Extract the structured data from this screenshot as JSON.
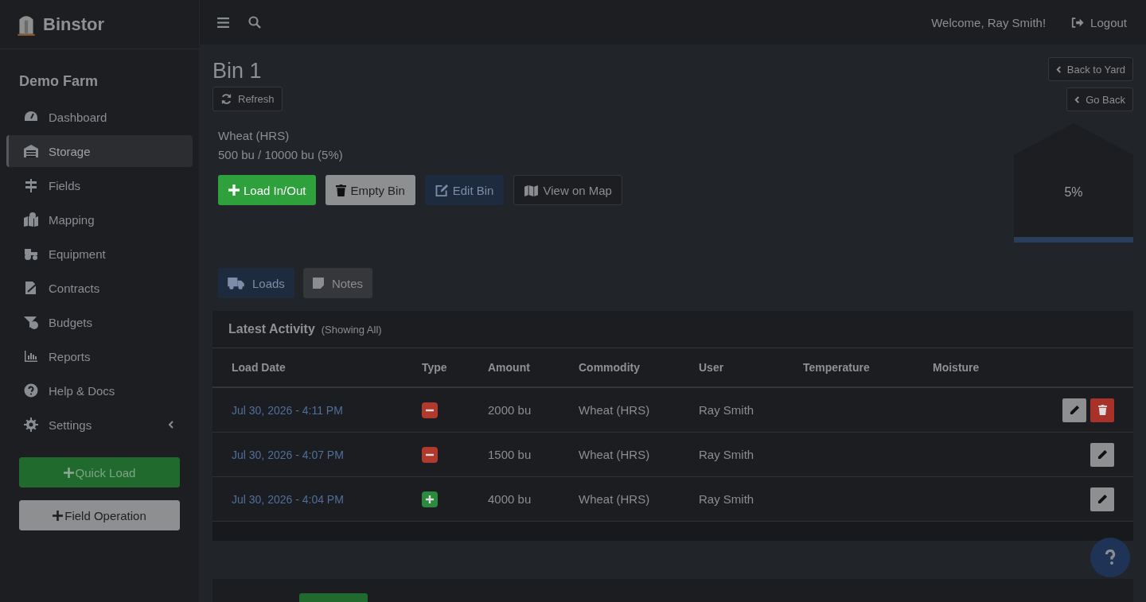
{
  "brand": {
    "name": "Binstor"
  },
  "topbar": {
    "welcome": "Welcome, Ray Smith!",
    "logout": "Logout"
  },
  "sidebar": {
    "farm": "Demo Farm",
    "items": [
      {
        "label": "Dashboard",
        "kind": "dashboard",
        "selected": false
      },
      {
        "label": "Storage",
        "kind": "storage",
        "selected": true
      },
      {
        "label": "Fields",
        "kind": "fields",
        "selected": false
      },
      {
        "label": "Mapping",
        "kind": "mapping",
        "selected": false
      },
      {
        "label": "Equipment",
        "kind": "equipment",
        "selected": false
      },
      {
        "label": "Contracts",
        "kind": "contracts",
        "selected": false
      },
      {
        "label": "Budgets",
        "kind": "budgets",
        "selected": false
      },
      {
        "label": "Reports",
        "kind": "reports",
        "selected": false
      },
      {
        "label": "Help & Docs",
        "kind": "help",
        "selected": false
      },
      {
        "label": "Settings",
        "kind": "settings",
        "selected": false,
        "expanded": false
      }
    ],
    "quick_load": "Quick Load",
    "field_operation": "Field Operation"
  },
  "bin": {
    "title": "Bin 1",
    "refresh": "Refresh",
    "commodity": "Wheat (HRS)",
    "capacity": "500 bu / 10000 bu (5%)",
    "percent": "5%",
    "actions": [
      {
        "label": "Load In/Out",
        "kind": "load"
      },
      {
        "label": "Empty Bin",
        "kind": "empty"
      },
      {
        "label": "Edit Bin",
        "kind": "edit"
      },
      {
        "label": "View on Map",
        "kind": "map"
      }
    ],
    "nav": [
      "Back to Yard",
      "Go Back"
    ]
  },
  "tabs": [
    {
      "label": "Loads",
      "kind": "loads",
      "selected": true
    },
    {
      "label": "Notes",
      "kind": "notes",
      "selected": false
    }
  ],
  "activity": {
    "title": "Latest Activity",
    "subtitle": "(Showing All)",
    "columns": [
      "Load Date",
      "Type",
      "Amount",
      "Commodity",
      "User",
      "Temperature",
      "Moisture"
    ],
    "rows": [
      {
        "date": "Jul 30, 2026 - 4:11 PM",
        "kind": "out",
        "amount": "2000 bu",
        "commodity": "Wheat (HRS)",
        "user": "Ray Smith",
        "deletable": true
      },
      {
        "date": "Jul 30, 2026 - 4:07 PM",
        "kind": "out",
        "amount": "1500 bu",
        "commodity": "Wheat (HRS)",
        "user": "Ray Smith",
        "deletable": false
      },
      {
        "date": "Jul 30, 2026 - 4:04 PM",
        "kind": "in",
        "amount": "4000 bu",
        "commodity": "Wheat (HRS)",
        "user": "Ray Smith",
        "deletable": false
      }
    ]
  }
}
